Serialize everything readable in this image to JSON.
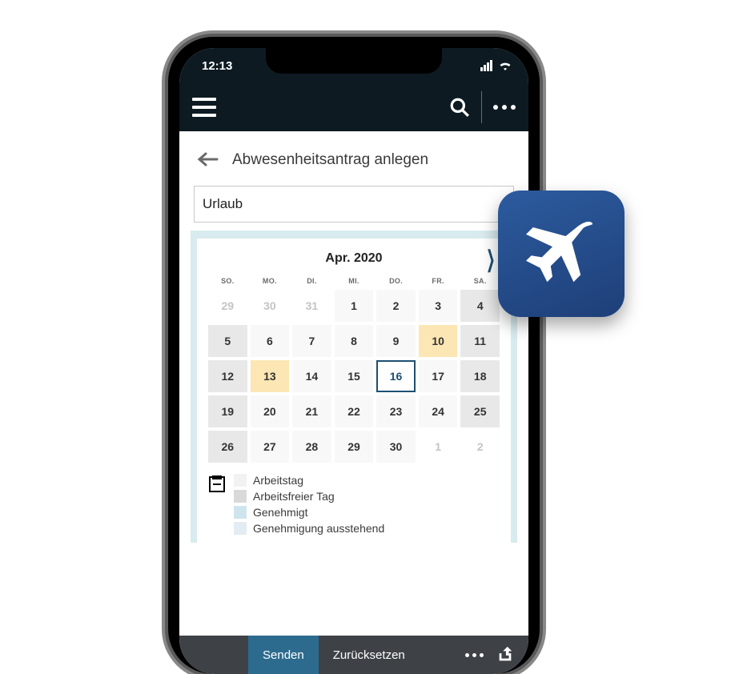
{
  "status": {
    "time": "12:13"
  },
  "page": {
    "title": "Abwesenheitsantrag anlegen",
    "absenceType": "Urlaub"
  },
  "calendar": {
    "month_label": "Apr. 2020",
    "weekdays": [
      "SO.",
      "MO.",
      "DI.",
      "MI.",
      "DO.",
      "FR.",
      "SA."
    ],
    "weeks": [
      [
        {
          "n": "29",
          "kind": "other"
        },
        {
          "n": "30",
          "kind": "other"
        },
        {
          "n": "31",
          "kind": "other"
        },
        {
          "n": "1",
          "kind": "work"
        },
        {
          "n": "2",
          "kind": "work"
        },
        {
          "n": "3",
          "kind": "work"
        },
        {
          "n": "4",
          "kind": "free"
        }
      ],
      [
        {
          "n": "5",
          "kind": "free"
        },
        {
          "n": "6",
          "kind": "work"
        },
        {
          "n": "7",
          "kind": "work"
        },
        {
          "n": "8",
          "kind": "work"
        },
        {
          "n": "9",
          "kind": "work"
        },
        {
          "n": "10",
          "kind": "highlight"
        },
        {
          "n": "11",
          "kind": "free"
        }
      ],
      [
        {
          "n": "12",
          "kind": "free"
        },
        {
          "n": "13",
          "kind": "highlight"
        },
        {
          "n": "14",
          "kind": "work"
        },
        {
          "n": "15",
          "kind": "work"
        },
        {
          "n": "16",
          "kind": "selected"
        },
        {
          "n": "17",
          "kind": "work"
        },
        {
          "n": "18",
          "kind": "free"
        }
      ],
      [
        {
          "n": "19",
          "kind": "free"
        },
        {
          "n": "20",
          "kind": "work"
        },
        {
          "n": "21",
          "kind": "work"
        },
        {
          "n": "22",
          "kind": "work"
        },
        {
          "n": "23",
          "kind": "work"
        },
        {
          "n": "24",
          "kind": "work"
        },
        {
          "n": "25",
          "kind": "free"
        }
      ],
      [
        {
          "n": "26",
          "kind": "free"
        },
        {
          "n": "27",
          "kind": "work"
        },
        {
          "n": "28",
          "kind": "work"
        },
        {
          "n": "29",
          "kind": "work"
        },
        {
          "n": "30",
          "kind": "work"
        },
        {
          "n": "1",
          "kind": "other"
        },
        {
          "n": "2",
          "kind": "other"
        }
      ]
    ]
  },
  "legend": {
    "items": [
      {
        "label": "Arbeitstag",
        "color": "#f2f2f2"
      },
      {
        "label": "Arbeitsfreier Tag",
        "color": "#d9d9d9"
      },
      {
        "label": "Genehmigt",
        "color": "#cfe5ee"
      },
      {
        "label": "Genehmigung ausstehend",
        "color": "#e3ecf2"
      }
    ]
  },
  "bottomBar": {
    "send": "Senden",
    "reset": "Zurücksetzen"
  }
}
